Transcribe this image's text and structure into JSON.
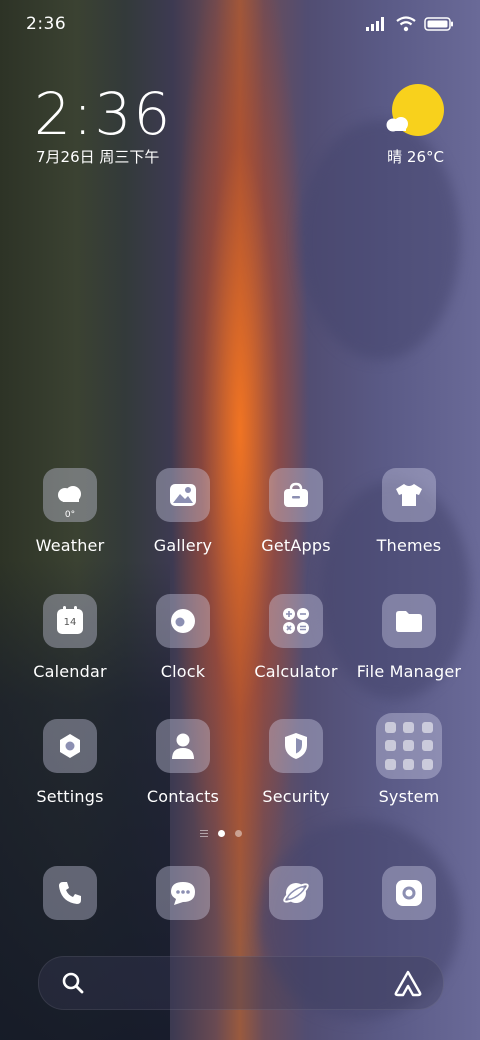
{
  "status_bar": {
    "time": "2:36",
    "icons": [
      "signal-icon",
      "wifi-icon",
      "battery-icon"
    ]
  },
  "clock_widget": {
    "time": "2:36",
    "date": "7月26日 周三下午"
  },
  "weather_widget": {
    "condition_icon": "sunny-cloud-icon",
    "text": "晴 26°C"
  },
  "apps": [
    {
      "label": "Weather",
      "icon": "weather-icon",
      "badge": "0°"
    },
    {
      "label": "Gallery",
      "icon": "gallery-icon"
    },
    {
      "label": "GetApps",
      "icon": "getapps-icon"
    },
    {
      "label": "Themes",
      "icon": "themes-icon"
    },
    {
      "label": "Calendar",
      "icon": "calendar-icon",
      "badge": "14"
    },
    {
      "label": "Clock",
      "icon": "clock-icon"
    },
    {
      "label": "Calculator",
      "icon": "calculator-icon"
    },
    {
      "label": "File Manager",
      "icon": "folder-icon"
    },
    {
      "label": "Settings",
      "icon": "settings-icon"
    },
    {
      "label": "Contacts",
      "icon": "contacts-icon"
    },
    {
      "label": "Security",
      "icon": "security-icon"
    },
    {
      "label": "System",
      "icon": "system-folder-icon"
    }
  ],
  "page_indicator": {
    "pages": 2,
    "current": 1
  },
  "dock": [
    {
      "icon": "phone-icon"
    },
    {
      "icon": "messages-icon"
    },
    {
      "icon": "browser-icon"
    },
    {
      "icon": "camera-icon"
    }
  ],
  "search_bar": {
    "left_icon": "search-icon",
    "right_icon": "assistant-icon"
  },
  "colors": {
    "sun": "#f8d11c",
    "tile": "rgba(210,210,235,0.38)"
  }
}
